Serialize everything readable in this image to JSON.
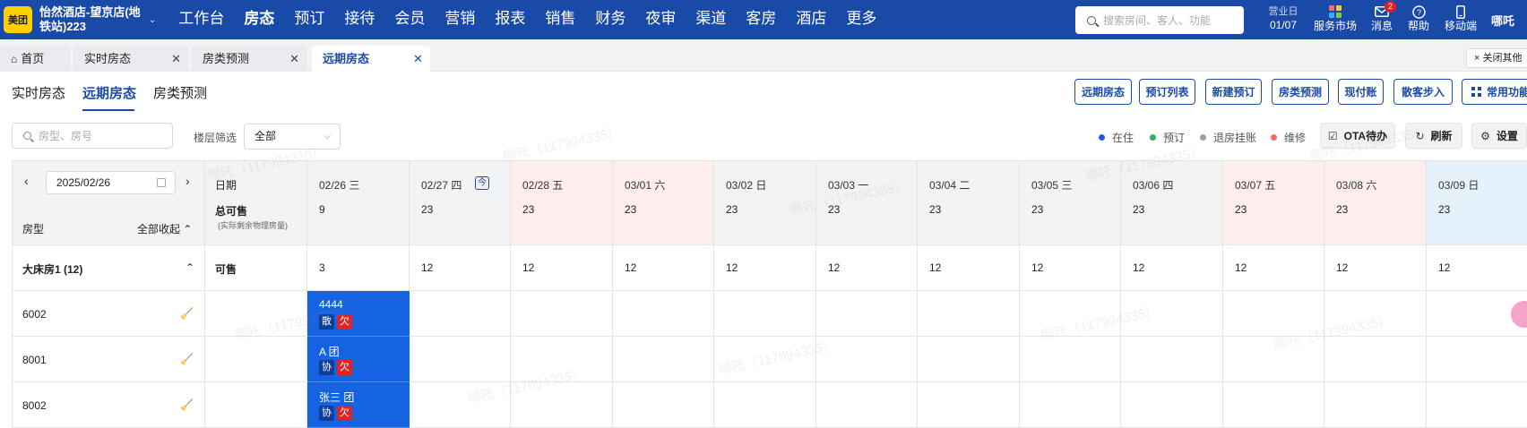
{
  "topnav": {
    "logo": "美团",
    "hotel_name": "怡然酒店-望京店(地铁站)223",
    "menu": [
      "工作台",
      "房态",
      "预订",
      "接待",
      "会员",
      "营销",
      "报表",
      "销售",
      "财务",
      "夜审",
      "渠道",
      "客房",
      "酒店",
      "更多"
    ],
    "active_menu": "房态",
    "search_placeholder": "搜索房间、客人、功能",
    "business_date_label": "营业日",
    "business_date": "01/07",
    "tools": [
      {
        "label": "服务市场",
        "icon": "grid-apps-icon"
      },
      {
        "label": "消息",
        "icon": "mail-icon",
        "badge": "2"
      },
      {
        "label": "帮助",
        "icon": "help-icon"
      },
      {
        "label": "移动端",
        "icon": "mobile-icon"
      }
    ],
    "user": "哪吒"
  },
  "page_tabs": {
    "home": "首页",
    "tabs": [
      "实时房态",
      "房类预测",
      "远期房态"
    ],
    "active": "远期房态",
    "close_others": "× 关闭其他"
  },
  "sub_tabs": [
    "实时房态",
    "远期房态",
    "房类预测"
  ],
  "actions": [
    "远期房态",
    "预订列表",
    "新建预订",
    "房类预测",
    "现付账",
    "散客步入",
    "常用功能"
  ],
  "filters": {
    "room_search_placeholder": "房型、房号",
    "floor_label": "楼层筛选",
    "floor_value": "全部"
  },
  "legend": [
    {
      "label": "在住",
      "color": "#1a5fd6"
    },
    {
      "label": "预订",
      "color": "#2bb464"
    },
    {
      "label": "退房挂账",
      "color": "#9aa0a8"
    },
    {
      "label": "维修",
      "color": "#ef6b6b"
    }
  ],
  "tools": {
    "ota": "OTA待办",
    "refresh": "刷新",
    "settings": "设置"
  },
  "grid": {
    "date_input": "2025/02/26",
    "header_date_label": "日期",
    "header_total_label": "总可售",
    "header_total_sub": "(实际剩余物理房量)",
    "room_type_label": "房型",
    "collapse_all": "全部收起",
    "days": [
      {
        "date": "02/26 三",
        "total": "9",
        "kind": "normal"
      },
      {
        "date": "02/27 四",
        "today": "今",
        "total": "23",
        "kind": "normal"
      },
      {
        "date": "02/28 五",
        "total": "23",
        "kind": "weekend"
      },
      {
        "date": "03/01 六",
        "total": "23",
        "kind": "weekend"
      },
      {
        "date": "03/02 日",
        "total": "23",
        "kind": "normal"
      },
      {
        "date": "03/03 一",
        "total": "23",
        "kind": "normal"
      },
      {
        "date": "03/04 二",
        "total": "23",
        "kind": "normal"
      },
      {
        "date": "03/05 三",
        "total": "23",
        "kind": "normal"
      },
      {
        "date": "03/06 四",
        "total": "23",
        "kind": "normal"
      },
      {
        "date": "03/07 五",
        "total": "23",
        "kind": "weekend"
      },
      {
        "date": "03/08 六",
        "total": "23",
        "kind": "weekend"
      },
      {
        "date": "03/09 日",
        "total": "23",
        "kind": "today-col"
      }
    ],
    "category": {
      "name": "大床房1 (12)",
      "available_label": "可售",
      "available": [
        "3",
        "12",
        "12",
        "12",
        "12",
        "12",
        "12",
        "12",
        "12",
        "12",
        "12",
        "12"
      ]
    },
    "rooms": [
      {
        "number": "6002",
        "booking": {
          "guest": "4444",
          "tags": [
            "散",
            "欠"
          ]
        }
      },
      {
        "number": "8001",
        "booking": {
          "guest": "A 团",
          "tags": [
            "协",
            "欠"
          ]
        }
      },
      {
        "number": "8002",
        "booking": {
          "guest": "张三 团",
          "tags": [
            "协",
            "欠"
          ]
        }
      }
    ],
    "watermark": "哪吒（117994335）"
  }
}
